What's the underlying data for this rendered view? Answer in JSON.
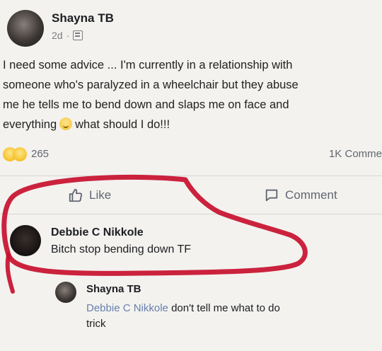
{
  "post": {
    "author": "Shayna TB",
    "time": "2d",
    "separator": "·",
    "text_line1": "I need some advice ... I'm currently in a relationship with",
    "text_line2": "someone who's paralyzed in a wheelchair but they abuse",
    "text_line3": "me he tells me to bend down and slaps me on face and",
    "text_line4a": "everything",
    "text_line4b": "what should I do!!!",
    "reaction_count": "265",
    "comments_count": "1K Comme"
  },
  "actions": {
    "like_label": "Like",
    "comment_label": "Comment"
  },
  "comments": [
    {
      "author": "Debbie C Nikkole",
      "text": "Bitch stop bending down TF"
    }
  ],
  "reply": {
    "author": "Shayna TB",
    "mention": "Debbie C Nikkole",
    "text_line1": "don't tell me what to do",
    "text_line2": "trick"
  },
  "colors": {
    "annotation": "#c8102e",
    "mention": "#6a80ad",
    "muted": "#606770"
  }
}
